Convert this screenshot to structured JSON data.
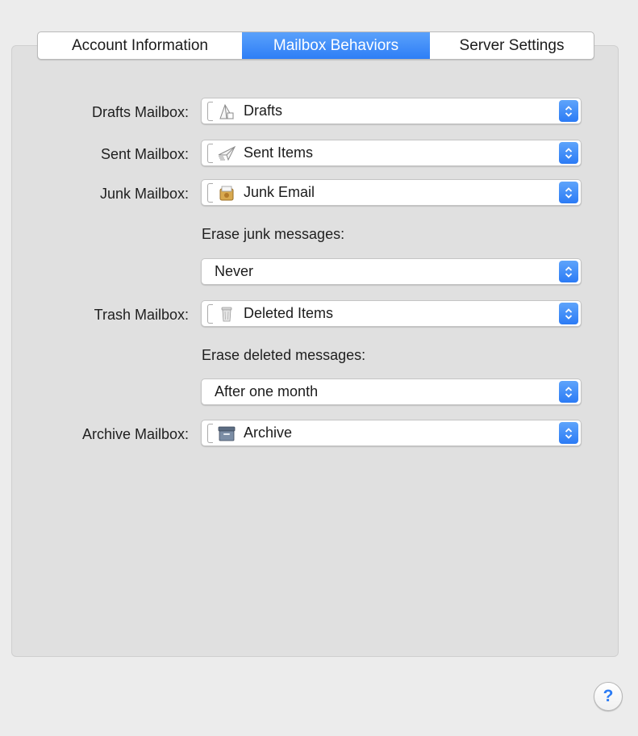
{
  "tabs": [
    {
      "label": "Account Information",
      "active": false
    },
    {
      "label": "Mailbox Behaviors",
      "active": true
    },
    {
      "label": "Server Settings",
      "active": false
    }
  ],
  "rows": {
    "drafts": {
      "label": "Drafts Mailbox:",
      "value": "Drafts",
      "icon": "drafts-icon"
    },
    "sent": {
      "label": "Sent Mailbox:",
      "value": "Sent Items",
      "icon": "sent-icon"
    },
    "junk": {
      "label": "Junk Mailbox:",
      "value": "Junk Email",
      "icon": "junk-icon"
    },
    "erase_junk": {
      "label": "Erase junk messages:",
      "value": "Never"
    },
    "trash": {
      "label": "Trash Mailbox:",
      "value": "Deleted Items",
      "icon": "trash-icon"
    },
    "erase_deleted": {
      "label": "Erase deleted messages:",
      "value": "After one month"
    },
    "archive": {
      "label": "Archive Mailbox:",
      "value": "Archive",
      "icon": "archive-icon"
    }
  },
  "help": {
    "label": "?"
  },
  "colors": {
    "accent": "#2e7ef6",
    "panel": "#e0e0e0",
    "window": "#ececec"
  }
}
